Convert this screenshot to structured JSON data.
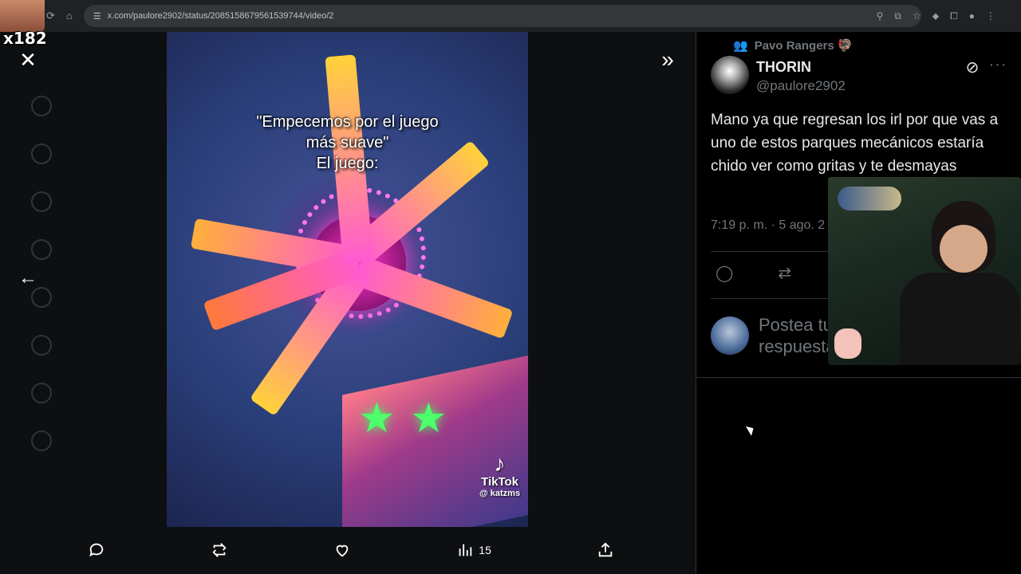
{
  "browser": {
    "url": "x.com/paulore2902/status/2085158679561539744/video/2"
  },
  "overlay": {
    "streamer_count": "x182"
  },
  "viewer": {
    "close_symbol": "✕",
    "next_symbol": "»",
    "prev_symbol": "←",
    "caption_line1": "\"Empecemos por el juego",
    "caption_line2": "más suave\"",
    "caption_line3": "El juego:",
    "watermark_brand": "TikTok",
    "watermark_user": "@ katzms",
    "actions": {
      "views_count": "15"
    }
  },
  "tweet": {
    "community": "Pavo Rangers 🦃",
    "display_name": "THORIN",
    "handle": "@paulore2902",
    "text": "Mano ya que regresan los irl por que vas a uno de estos parques mecánicos estaría chido ver como gritas y te desmayas",
    "time": "7:19 p. m. · 5 ago. 2",
    "reply_placeholder": "Postea tu respuesta"
  },
  "colors": {
    "background": "#000000",
    "text_primary": "#e7e9ea",
    "text_secondary": "#71767b",
    "border": "#2f3336"
  }
}
